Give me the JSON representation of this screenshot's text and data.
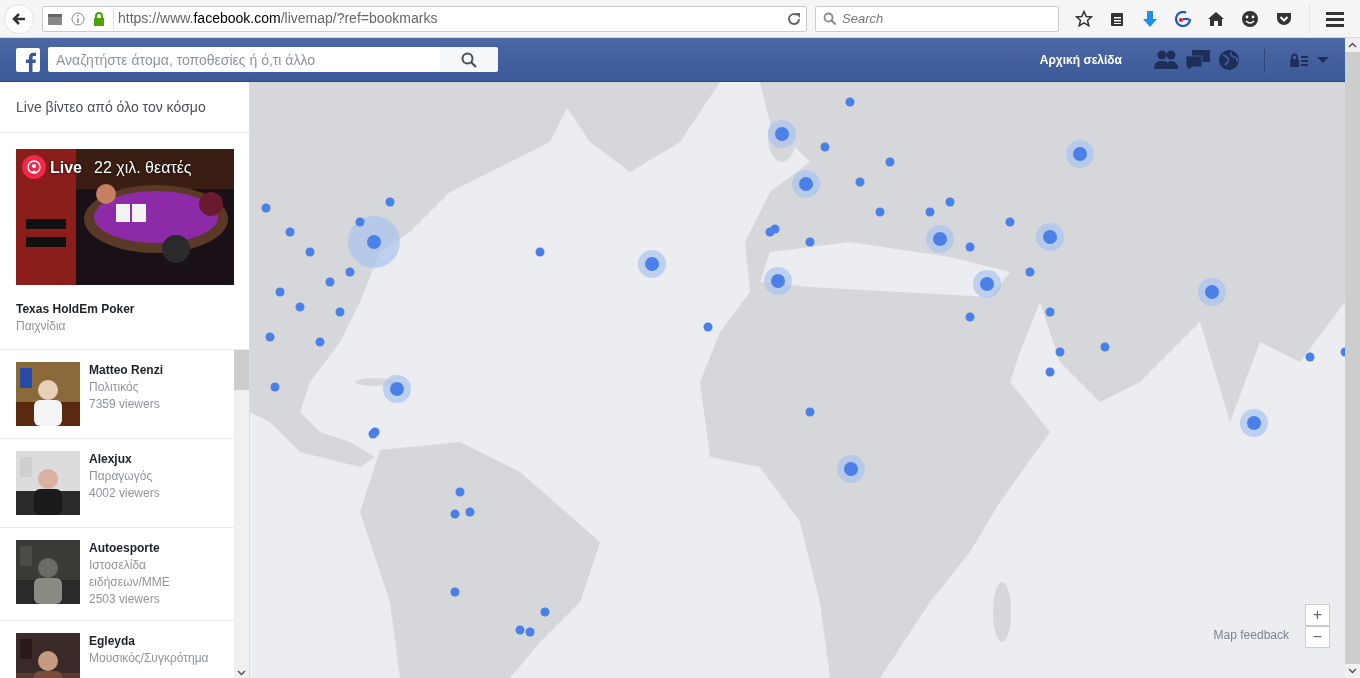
{
  "browser": {
    "url_prefix": "https://www.",
    "url_domain": "facebook.com",
    "url_path": "/livemap/?ref=bookmarks",
    "search_placeholder": "Search"
  },
  "header": {
    "search_placeholder": "Αναζητήστε άτομα, τοποθεσίες ή ό,τι άλλο",
    "home_link": "Αρχική σελίδα"
  },
  "sidebar": {
    "title": "Live βίντεο από όλο τον κόσμο",
    "featured": {
      "live_label": "Live",
      "viewers": "22 χιλ. θεατές",
      "title": "Texas HoldEm Poker",
      "category": "Παιχνίδια"
    },
    "streams": [
      {
        "name": "Matteo Renzi",
        "category": "Πολιτικός",
        "viewers": "7359 viewers"
      },
      {
        "name": "Alexjux",
        "category": "Παραγωγός",
        "viewers": "4002 viewers"
      },
      {
        "name": "Autoesporte",
        "category": "Ιστοσελίδα ειδήσεων/MME",
        "viewers": "2503 viewers"
      },
      {
        "name": "Egleyda",
        "category": "Μουσικός/Συγκρότημα"
      }
    ]
  },
  "map": {
    "feedback": "Map feedback",
    "zoom_in": "+",
    "zoom_out": "−"
  }
}
